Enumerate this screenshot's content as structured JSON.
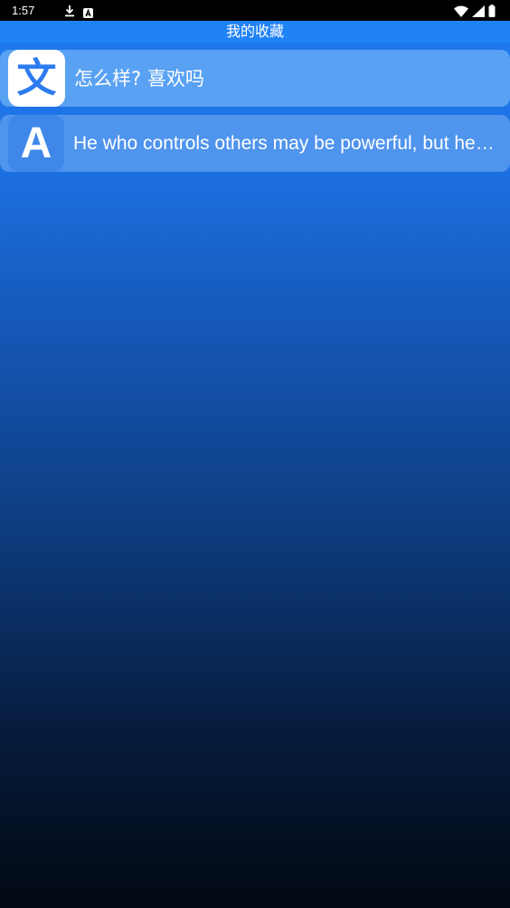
{
  "status_bar": {
    "time": "1:57",
    "icons": [
      "download-icon",
      "a-notification-icon",
      "wifi-icon",
      "signal-icon",
      "battery-icon"
    ]
  },
  "header": {
    "title": "我的收藏"
  },
  "favorites": {
    "items": [
      {
        "icon_text": "文",
        "icon": "wen-translate-icon",
        "text": "怎么样? 喜欢吗"
      },
      {
        "icon_text": "A",
        "icon": "a-letter-icon",
        "text": "He who controls others may be powerful, but he who has mastered himself is mightier still."
      }
    ]
  },
  "colors": {
    "title_bar": "#1f82f6",
    "gradient_top": "#1f7bf1",
    "gradient_bottom": "#020912",
    "item_bg_1": "#59a1f3",
    "item_bg_2": "#4f94ed",
    "icon_accent": "#2c7bf0"
  }
}
